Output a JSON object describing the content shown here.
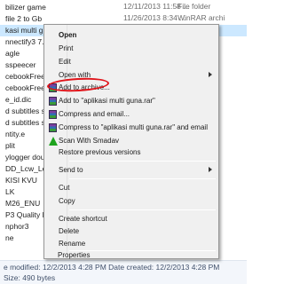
{
  "files": [
    {
      "name": "bilizer game",
      "date": "12/11/2013 11:58 ...",
      "type": "File folder"
    },
    {
      "name": "file 2 to Gb",
      "date": "11/26/2013 8:34 ...",
      "type": "WinRAR archi"
    },
    {
      "name": "kasi multi gu...",
      "date": "",
      "type": "",
      "selected": true
    },
    {
      "name": "nnectify3 7.1.2",
      "date": "",
      "type": ""
    },
    {
      "name": "agle",
      "date": "",
      "type": ""
    },
    {
      "name": "sspeecer",
      "date": "",
      "type": ""
    },
    {
      "name": "cebookFreezer",
      "date": "",
      "type": ""
    },
    {
      "name": "cebookFreezer",
      "date": "",
      "type": ""
    },
    {
      "name": "e_id.dic",
      "date": "",
      "type": ""
    },
    {
      "name": "d subtitles setu",
      "date": "",
      "type": ""
    },
    {
      "name": "d subtitles setu",
      "date": "",
      "type": ""
    },
    {
      "name": "ntity.e",
      "date": "",
      "type": ""
    },
    {
      "name": "plit",
      "date": "",
      "type": ""
    },
    {
      "name": "ylogger douglas",
      "date": "",
      "type": ""
    },
    {
      "name": "DD_Lcw_Level_F",
      "date": "",
      "type": ""
    },
    {
      "name": "KISI KVU",
      "date": "",
      "type": ""
    },
    {
      "name": "LK",
      "date": "",
      "type": ""
    },
    {
      "name": "M26_ENU",
      "date": "",
      "type": ""
    },
    {
      "name": "P3 Quality Mod",
      "date": "",
      "type": ""
    },
    {
      "name": "nphor3",
      "date": "",
      "type": ""
    },
    {
      "name": "ne",
      "date": "",
      "type": ""
    }
  ],
  "status": {
    "line1": "e modified: 12/2/2013 4:28 PM      Date created: 12/2/2013 4:28 PM",
    "line2": "Size: 490 bytes"
  },
  "menu": {
    "open": "Open",
    "print": "Print",
    "edit": "Edit",
    "open_with": "Open with",
    "add_to_archive": "Add to archive...",
    "add_to_named": "Add to \"aplikasi multi guna.rar\"",
    "compress_email": "Compress and email...",
    "compress_named_email": "Compress to \"aplikasi multi guna.rar\" and email",
    "scan_smadav": "Scan With Smadav",
    "restore": "Restore previous versions",
    "send_to": "Send to",
    "cut": "Cut",
    "copy": "Copy",
    "create_shortcut": "Create shortcut",
    "delete": "Delete",
    "rename": "Rename",
    "properties": "Properties"
  },
  "colors": {
    "annotation": "#e0141a",
    "selection": "#cce8ff"
  }
}
